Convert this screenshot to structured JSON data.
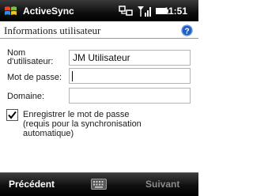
{
  "status_bar": {
    "app_title": "ActiveSync",
    "time": "11:51",
    "icons": [
      "windows-start-icon",
      "connectivity-icon",
      "signal-strength-icon",
      "battery-icon"
    ]
  },
  "header": {
    "title": "Informations utilisateur",
    "help_icon": "help-icon"
  },
  "form": {
    "username": {
      "label_line1": "Nom",
      "label_line2": "d'utilisateur:",
      "value": "JM Utilisateur"
    },
    "password": {
      "label": "Mot de passe:",
      "value": ""
    },
    "domain": {
      "label": "Domaine:",
      "value": ""
    },
    "save_password": {
      "checked": true,
      "label_line1": "Enregistrer le mot de passe",
      "label_line2": "(requis pour la synchronisation",
      "label_line3": "automatique)"
    }
  },
  "soft_keys": {
    "left": "Précédent",
    "center_icon": "keyboard-icon",
    "right": "Suivant"
  },
  "colors": {
    "bar_background": "#000000",
    "soft_key_active": "#ffffff",
    "soft_key_disabled": "#8a8a8a",
    "help_icon": "#1f5fc4"
  }
}
